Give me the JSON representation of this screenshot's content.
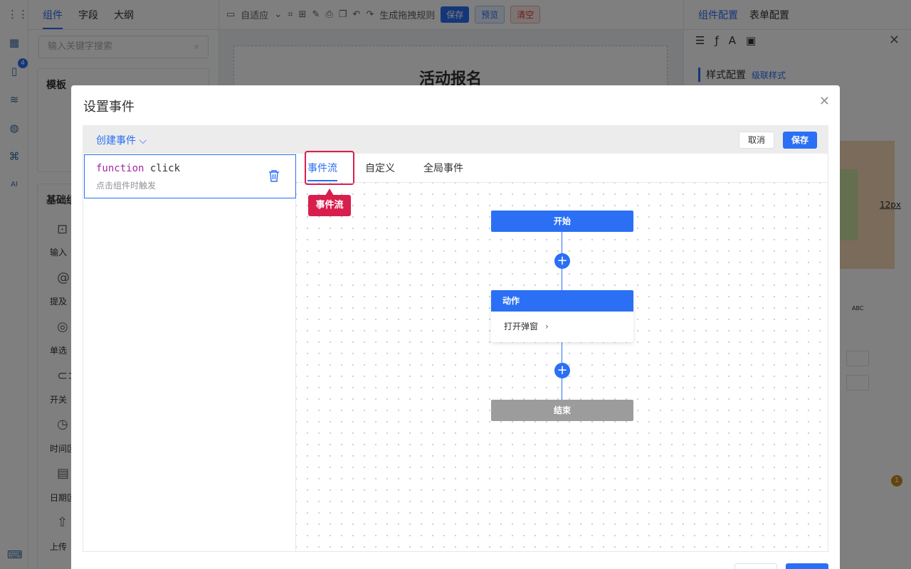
{
  "left_panel": {
    "tabs": [
      "组件",
      "字段",
      "大纲"
    ],
    "search_placeholder": "输入关键字搜索",
    "template_title": "模板",
    "basic_title": "基础组",
    "items": [
      "输入",
      "提及",
      "单选",
      "开关",
      "时间区",
      "日期区",
      "上传"
    ]
  },
  "rail": {
    "badge": "4",
    "ai_label": "AI"
  },
  "toolbar": {
    "layout_label": "自适应",
    "generate_label": "生成拖拽规则",
    "save_label": "保存",
    "preview_label": "预览",
    "clear_label": "清空"
  },
  "canvas": {
    "form_title": "活动报名"
  },
  "right_panel": {
    "tabs": [
      "组件配置",
      "表单配置"
    ],
    "section_title": "样式配置",
    "cascade_link": "级联样式",
    "size_label": "12px",
    "abc_label": "ABC",
    "badge": "1"
  },
  "modal": {
    "title": "设置事件",
    "create_event": "创建事件",
    "cancel": "取消",
    "save": "保存",
    "event": {
      "keyword": "function",
      "name": "click",
      "description": "点击组件时触发"
    },
    "tabs": [
      "事件流",
      "自定义",
      "全局事件"
    ],
    "callout": "事件流",
    "flow": {
      "start": "开始",
      "action_title": "动作",
      "action_item": "打开弹窗",
      "end": "结束"
    }
  },
  "colors": {
    "primary": "#2b6ff5",
    "highlight": "#d81e4d",
    "end_node": "#9c9c9c"
  }
}
